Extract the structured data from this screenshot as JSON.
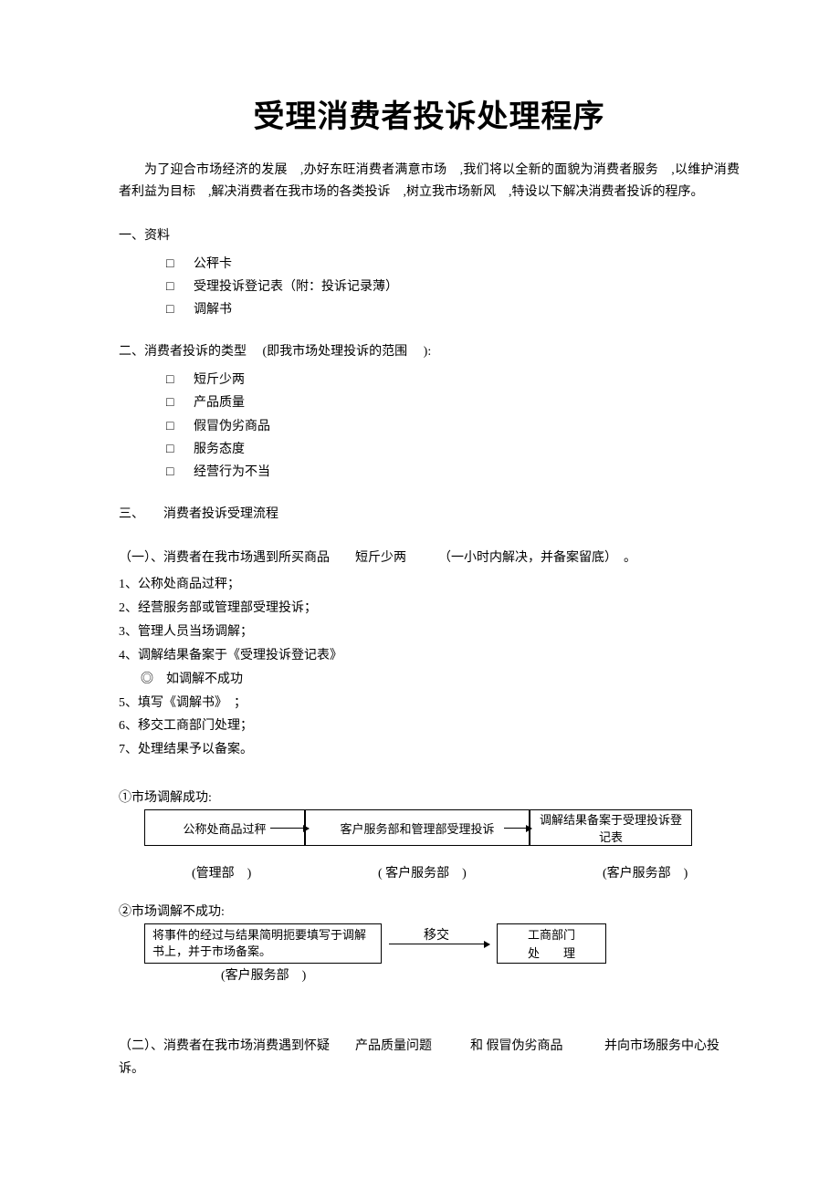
{
  "title": "受理消费者投诉处理程序",
  "intro": "为了迎合市场经济的发展　,办好东旺消费者满意市场　,我们将以全新的面貌为消费者服务　,以维护消费者利益为目标　,解决消费者在我市场的各类投诉　,树立我市场新风　,特设以下解决消费者投诉的程序。",
  "sec1": {
    "head": "一、资料",
    "items": [
      "公秤卡",
      "受理投诉登记表（附：投诉记录薄）",
      "调解书"
    ]
  },
  "sec2": {
    "head": "二、消费者投诉的类型　 (即我市场处理投诉的范围　 ):",
    "items": [
      "短斤少两",
      "产品质量",
      "假冒伪劣商品",
      "服务态度",
      "经营行为不当"
    ]
  },
  "sec3": {
    "head": "三、　　消费者投诉受理流程",
    "sub1_head": "（一）、消费者在我市场遇到所买商品　　短斤少两　　　（一小时内解决，并备案留底）　。",
    "steps": [
      "1、公称处商品过秤；",
      "2、经营服务部或管理部受理投诉；",
      "3、管理人员当场调解；",
      "4、调解结果备案于《受理投诉登记表》",
      "◎　如调解不成功",
      "5、填写《调解书》　；",
      "6、移交工商部门处理；",
      "7、处理结果予以备案。"
    ],
    "flow1_label": "①市场调解成功:",
    "flow1": {
      "box1": "公称处商品过秤 客户服务部和管理部受理投诉 调解结果备案于受理投诉登记表",
      "cap1": "(管理部　)",
      "cap2": "( 客户服务部　)",
      "cap3": "(客户服务部　)"
    },
    "flow2_label": "②市场调解不成功:",
    "flow2": {
      "boxL": "将事件的经过与结果简明扼要填写于调解书上，并于市场备案。",
      "capL": "(客户服务部　)",
      "arrow_label": "移交",
      "boxR_line1": "工商部门",
      "boxR_line2": "处　　理"
    },
    "sub2_head": "（二）、消费者在我市场消费遇到怀疑　　产品质量问题　　　和 假冒伪劣商品 　　　并向市场服务中心投诉。"
  }
}
